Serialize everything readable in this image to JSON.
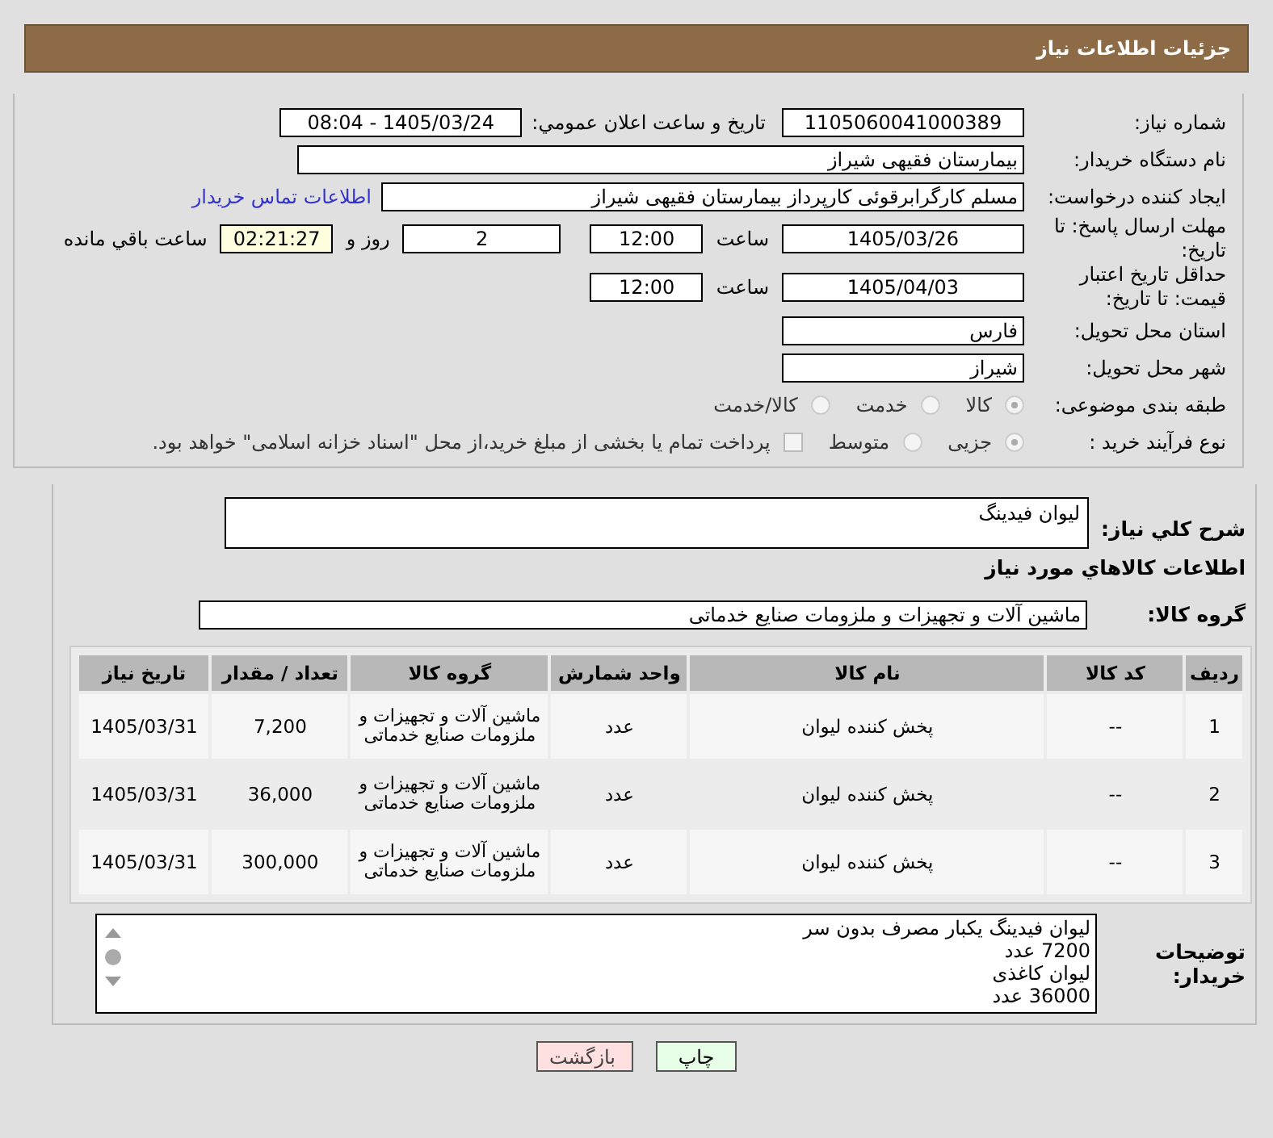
{
  "header": {
    "title": "جزئیات اطلاعات نیاز"
  },
  "need_number": {
    "label": "شماره نیاز:",
    "value": "1105060041000389"
  },
  "announce": {
    "label": "تاریخ و ساعت اعلان عمومي:",
    "value": "1405/03/24 - 08:04"
  },
  "buyer": {
    "label": "نام دستگاه خریدار:",
    "value": "بیمارستان فقیهی شیراز"
  },
  "requester": {
    "label": "ایجاد کننده درخواست:",
    "value": "مسلم کارگرابرقوئی کارپرداز  بیمارستان فقیهی شیراز",
    "link": "اطلاعات تماس خریدار"
  },
  "deadline": {
    "label": "مهلت ارسال پاسخ: تا تاریخ:",
    "date": "1405/03/26",
    "time_label": "ساعت",
    "time": "12:00",
    "days": "2",
    "days_label": "روز و",
    "remaining": "02:21:27",
    "remaining_label": "ساعت باقي مانده"
  },
  "validity": {
    "label": "حداقل تاریخ اعتبار قیمت: تا تاریخ:",
    "date": "1405/04/03",
    "time_label": "ساعت",
    "time": "12:00"
  },
  "province": {
    "label": "استان محل تحویل:",
    "value": "فارس"
  },
  "city": {
    "label": "شهر محل تحویل:",
    "value": "شیراز"
  },
  "category": {
    "label": "طبقه بندی موضوعی:",
    "options": [
      {
        "label": "كالا",
        "selected": true
      },
      {
        "label": "خدمت",
        "selected": false
      },
      {
        "label": "كالا/خدمت",
        "selected": false
      }
    ]
  },
  "purchase_type": {
    "label": "نوع فرآیند خرید :",
    "options": [
      {
        "label": "جزیی",
        "selected": true
      },
      {
        "label": "متوسط",
        "selected": false
      }
    ],
    "payment": {
      "label": "پرداخت تمام یا بخشی از مبلغ خرید،از محل \"اسناد خزانه اسلامی\" خواهد بود.",
      "checked": false
    }
  },
  "description": {
    "label": "شرح کلي نياز:",
    "value": "لیوان فیدینگ"
  },
  "goods_heading": "اطلاعات کالاهاي مورد نياز",
  "goods_group": {
    "label": "گروه کالا:",
    "value": "ماشین آلات و تجهیزات و ملزومات صنایع خدماتی"
  },
  "table": {
    "columns": [
      "ردیف",
      "کد کالا",
      "نام کالا",
      "واحد شمارش",
      "گروه کالا",
      "تعداد / مقدار",
      "تاریخ نیاز"
    ],
    "rows": [
      [
        "1",
        "--",
        "پخش کننده لیوان",
        "عدد",
        "ماشین آلات و تجهیزات و ملزومات صنایع خدماتی",
        "7,200",
        "1405/03/31"
      ],
      [
        "2",
        "--",
        "پخش کننده لیوان",
        "عدد",
        "ماشین آلات و تجهیزات و ملزومات صنایع خدماتی",
        "36,000",
        "1405/03/31"
      ],
      [
        "3",
        "--",
        "پخش کننده لیوان",
        "عدد",
        "ماشین آلات و تجهیزات و ملزومات صنایع خدماتی",
        "300,000",
        "1405/03/31"
      ]
    ]
  },
  "notes": {
    "label": "توضیحات خریدار:",
    "lines": [
      "لیوان فیدینگ یکبار مصرف بدون سر",
      "7200 عدد",
      "لیوان کاغذی",
      "36000 عدد"
    ]
  },
  "buttons": [
    {
      "label": "چاپ",
      "kind": "print"
    },
    {
      "label": "بازگشت",
      "kind": "back"
    }
  ]
}
